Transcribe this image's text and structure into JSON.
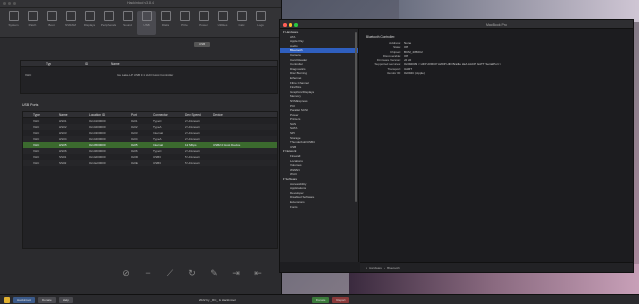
{
  "hackintool": {
    "title": "Hackintool v3.8.4",
    "toolbar": [
      {
        "label": "System",
        "icon": "apple-icon"
      },
      {
        "label": "Patch",
        "icon": "wrench-icon"
      },
      {
        "label": "Boot",
        "icon": "boot-icon"
      },
      {
        "label": "NVRAM",
        "icon": "nvram-icon"
      },
      {
        "label": "Displays",
        "icon": "display-icon"
      },
      {
        "label": "Peripherals",
        "icon": "peripheral-icon"
      },
      {
        "label": "Sound",
        "icon": "speaker-icon"
      },
      {
        "label": "USB",
        "icon": "usb-icon"
      },
      {
        "label": "Disks",
        "icon": "disk-icon"
      },
      {
        "label": "PCIe",
        "icon": "pcie-icon"
      },
      {
        "label": "Power",
        "icon": "power-icon"
      },
      {
        "label": "Utilities",
        "icon": "utilities-icon"
      },
      {
        "label": "Calc",
        "icon": "calc-icon"
      },
      {
        "label": "Logs",
        "icon": "logs-icon"
      }
    ],
    "active_tab": "USB",
    "segment_label": "USB",
    "usb_controllers": {
      "columns": [
        "Type",
        "ID",
        "Name"
      ],
      "rows": [
        [
          "XHC",
          "8086",
          "Ice Lake-LP USB 3.1 xHCI Host Controller"
        ]
      ]
    },
    "usb_ports": {
      "title": "USB Ports",
      "columns": [
        "Type",
        "Name",
        "Location ID",
        "Port",
        "Connector",
        "Dev Speed",
        "Device"
      ],
      "rows": [
        [
          "XHC",
          "HS01",
          "0x14100000",
          "0x01",
          "TypeC",
          "2 Unknown",
          ""
        ],
        [
          "XHC",
          "HS02",
          "0x14200000",
          "0x02",
          "TypeA",
          "2 Unknown",
          ""
        ],
        [
          "XHC",
          "HS03",
          "0x14300000",
          "0x03",
          "Internal",
          "2 Unknown",
          ""
        ],
        [
          "XHC",
          "HS04",
          "0x14400000",
          "0x04",
          "TypeA",
          "2 Unknown",
          ""
        ],
        [
          "XHC",
          "HS05",
          "0x14500000",
          "0x05",
          "Internal",
          "12 Mbps",
          "USB2.0 Host Device"
        ],
        [
          "XHC",
          "HS06",
          "0x14600000",
          "0x06",
          "TypeC",
          "2 Unknown",
          ""
        ],
        [
          "XHC",
          "SS01",
          "0x14d00000",
          "0x0D",
          "USB3",
          "5 Unknown",
          ""
        ],
        [
          "XHC",
          "SS02",
          "0x14e00000",
          "0x0E",
          "USB3",
          "5 Unknown",
          ""
        ]
      ],
      "selected_row": 4
    },
    "bottom_tools": [
      "clear-icon",
      "remove-icon",
      "broom-icon",
      "refresh-icon",
      "pencil-icon",
      "import-icon",
      "export-icon"
    ],
    "status": {
      "unlock_label": "Hackintool",
      "btn1": "Donate",
      "btn2": "Help",
      "center": "2022 by _RC_ & Hackintool",
      "btn3": "Donate",
      "btn4": "Report"
    }
  },
  "sysinfo": {
    "window_title": "MacBook Pro",
    "sidebar": [
      {
        "label": "▾ Hardware",
        "level": 0
      },
      {
        "label": "ATA",
        "level": 1
      },
      {
        "label": "Apple Pay",
        "level": 1
      },
      {
        "label": "Audio",
        "level": 1
      },
      {
        "label": "Bluetooth",
        "level": 1,
        "selected": true
      },
      {
        "label": "Camera",
        "level": 1
      },
      {
        "label": "Card Reader",
        "level": 1
      },
      {
        "label": "Controller",
        "level": 1
      },
      {
        "label": "Diagnostics",
        "level": 1
      },
      {
        "label": "Disc Burning",
        "level": 1
      },
      {
        "label": "Ethernet",
        "level": 1
      },
      {
        "label": "Fibre Channel",
        "level": 1
      },
      {
        "label": "FireWire",
        "level": 1
      },
      {
        "label": "Graphics/Displays",
        "level": 1
      },
      {
        "label": "Memory",
        "level": 1
      },
      {
        "label": "NVMExpress",
        "level": 1
      },
      {
        "label": "PCI",
        "level": 1
      },
      {
        "label": "Parallel SCSI",
        "level": 1
      },
      {
        "label": "Power",
        "level": 1
      },
      {
        "label": "Printers",
        "level": 1
      },
      {
        "label": "SAS",
        "level": 1
      },
      {
        "label": "SATA",
        "level": 1
      },
      {
        "label": "SPI",
        "level": 1
      },
      {
        "label": "Storage",
        "level": 1
      },
      {
        "label": "Thunderbolt/USB4",
        "level": 1
      },
      {
        "label": "USB",
        "level": 1
      },
      {
        "label": "▾ Network",
        "level": 0
      },
      {
        "label": "Firewall",
        "level": 1
      },
      {
        "label": "Locations",
        "level": 1
      },
      {
        "label": "Volumes",
        "level": 1
      },
      {
        "label": "WWAN",
        "level": 1
      },
      {
        "label": "Wi-Fi",
        "level": 1
      },
      {
        "label": "▾ Software",
        "level": 0
      },
      {
        "label": "Accessibility",
        "level": 1
      },
      {
        "label": "Applications",
        "level": 1
      },
      {
        "label": "Developer",
        "level": 1
      },
      {
        "label": "Disabled Software",
        "level": 1
      },
      {
        "label": "Extensions",
        "level": 1
      },
      {
        "label": "Fonts",
        "level": 1
      }
    ],
    "detail": {
      "heading": "Bluetooth Controller:",
      "rows": [
        [
          "Address:",
          "None"
        ],
        [
          "State:",
          "Off"
        ],
        [
          "Chipset:",
          "BCM_4350C2"
        ],
        [
          "Discoverable:",
          "Off"
        ],
        [
          "Firmware Version:",
          "v0 c0"
        ],
        [
          "Supported services:",
          "0x392039 < HFP AVRCP A2DP HID Braille LEA AACP GATT SerialPort >"
        ],
        [
          "Transport:",
          "UART"
        ],
        [
          "Vendor ID:",
          "0x004C (Apple)"
        ]
      ]
    },
    "path": [
      "▪",
      "Hardware",
      "›",
      "Bluetooth"
    ]
  },
  "colors": {
    "selected_row": "#3b6a2e",
    "sidebar_selected": "#2f5fbf",
    "traffic_red": "#ff5f57",
    "traffic_yellow": "#febc2e",
    "traffic_green": "#28c840"
  }
}
